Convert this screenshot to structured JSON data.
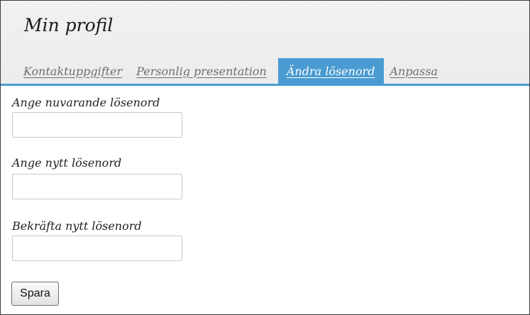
{
  "page": {
    "title": "Min profil"
  },
  "tabs": [
    {
      "label": "Kontaktuppgifter",
      "active": false
    },
    {
      "label": "Personlig presentation",
      "active": false
    },
    {
      "label": "Ändra lösenord",
      "active": true
    },
    {
      "label": "Anpassa",
      "active": false
    }
  ],
  "form": {
    "current_password": {
      "label": "Ange nuvarande lösenord",
      "value": ""
    },
    "new_password": {
      "label": "Ange nytt lösenord",
      "value": ""
    },
    "confirm_password": {
      "label": "Bekräfta nytt lösenord",
      "value": ""
    },
    "save_label": "Spara"
  },
  "colors": {
    "active_tab": "#4a9bd1",
    "header_bg": "#efefef"
  }
}
